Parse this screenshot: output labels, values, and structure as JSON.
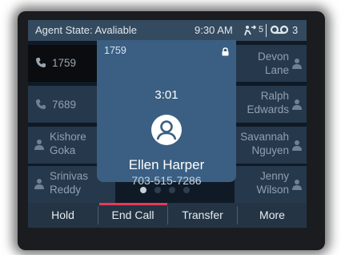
{
  "status": {
    "agent_state": "Agent State: Avaliable",
    "time": "9:30 AM",
    "transfer_count": "5",
    "voicemail_count": "3"
  },
  "lines": {
    "left": [
      {
        "label_line1": "1759",
        "label_line2": "",
        "icon": "handset-icon",
        "active": true
      },
      {
        "label_line1": "7689",
        "label_line2": "",
        "icon": "handset-icon",
        "active": false
      },
      {
        "label_line1": "Kishore",
        "label_line2": "Goka",
        "icon": "person-icon",
        "active": false
      },
      {
        "label_line1": "Srinivas",
        "label_line2": "Reddy",
        "icon": "person-icon",
        "active": false
      }
    ],
    "right": [
      {
        "label_line1": "Devon",
        "label_line2": "Lane",
        "icon": "person-icon"
      },
      {
        "label_line1": "Ralph",
        "label_line2": "Edwards",
        "icon": "person-icon"
      },
      {
        "label_line1": "Savannah",
        "label_line2": "Nguyen",
        "icon": "person-icon"
      },
      {
        "label_line1": "Jenny",
        "label_line2": "Wilson",
        "icon": "person-icon"
      }
    ]
  },
  "call_popup": {
    "extension": "1759",
    "timer": "3:01",
    "caller_name": "Ellen Harper",
    "caller_number": "703-515-7286"
  },
  "pagination": {
    "current_page": 1,
    "total_pages": 4
  },
  "softkeys": [
    "Hold",
    "End Call",
    "Transfer",
    "More"
  ],
  "colors": {
    "statusbar": "#344a5e",
    "popup": "#3a5f82",
    "active_softkey_underline": "#e73a5a",
    "softkey_bar": "#243444"
  }
}
